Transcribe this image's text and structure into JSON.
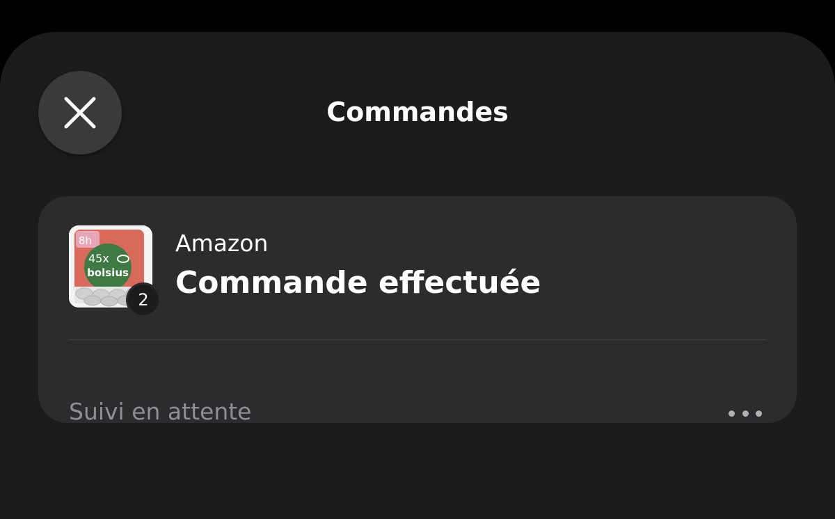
{
  "header": {
    "title": "Commandes",
    "close_icon": "close-icon"
  },
  "order": {
    "merchant": "Amazon",
    "status": "Commande effectuée",
    "item_count": "2",
    "tracking_status": "Suivi en attente",
    "more_icon": "ellipsis-icon",
    "thumbnail": {
      "pack_count": "45x",
      "brand": "bolsius",
      "tag": "8h"
    }
  },
  "colors": {
    "background": "#000000",
    "sheet": "#1c1c1e",
    "card": "#2c2c2e",
    "button": "#3a3a3c",
    "text_primary": "#ffffff",
    "text_secondary": "#8e8e93"
  }
}
